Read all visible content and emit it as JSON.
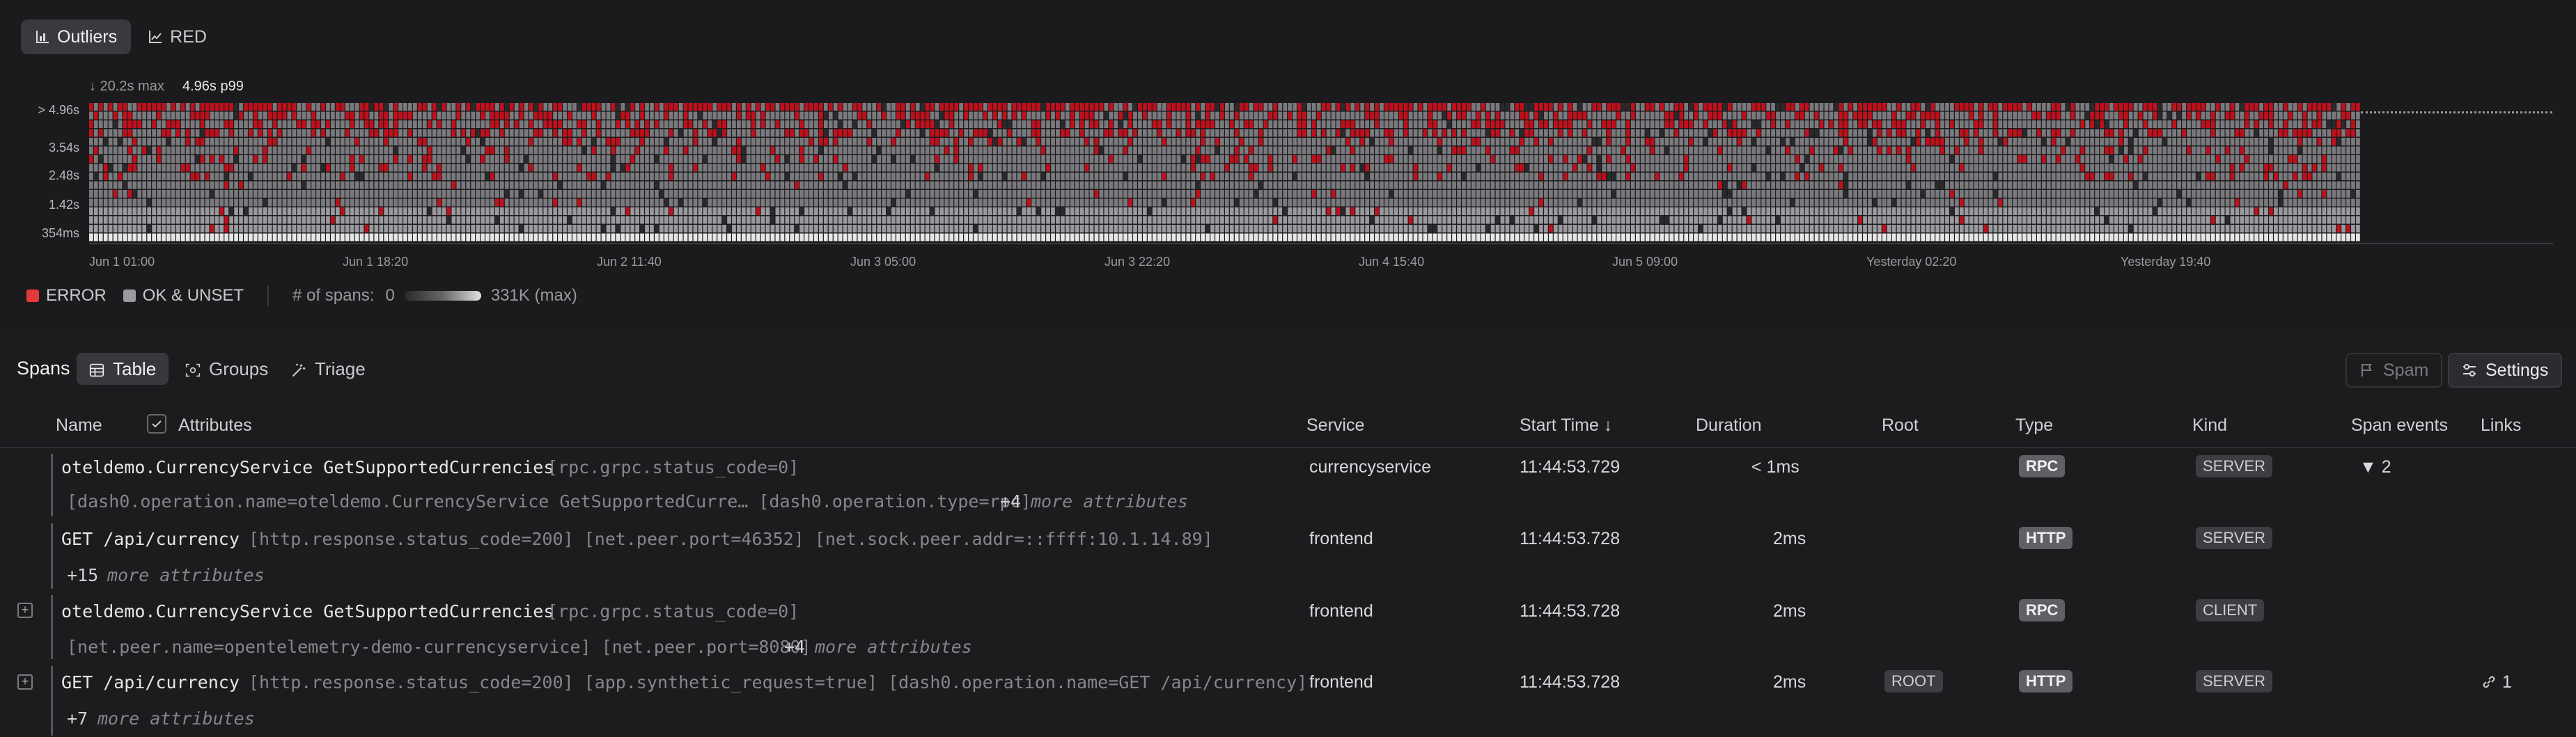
{
  "view_tabs": [
    {
      "label": "Outliers",
      "active": true
    },
    {
      "label": "RED",
      "active": false
    }
  ],
  "chart_header": {
    "max_label": "↓ 20.2s max",
    "p99_label": "4.96s p99"
  },
  "chart_data": {
    "type": "heatmap",
    "title": "",
    "y_ticks": [
      "> 4.96s",
      "3.54s",
      "2.48s",
      "1.42s",
      "354ms"
    ],
    "x_ticks": [
      "Jun 1 01:00",
      "Jun 1 18:20",
      "Jun 2 11:40",
      "Jun 3 05:00",
      "Jun 3 22:20",
      "Jun 4 15:40",
      "Jun 5 09:00",
      "Yesterday 02:20",
      "Yesterday 19:40"
    ],
    "legend": [
      {
        "name": "ERROR",
        "color": "#e5383b"
      },
      {
        "name": "OK & UNSET",
        "color": "#9a9a9e"
      }
    ],
    "count_scale": {
      "label": "# of spans:",
      "min": "0",
      "max": "331K (max)"
    },
    "colors": {
      "error": "#c0101c",
      "ok": "#7a7a7e",
      "bright": "#e6e6e6"
    }
  },
  "toolbar": {
    "title": "Spans",
    "tabs": [
      {
        "label": "Table",
        "active": true
      },
      {
        "label": "Groups",
        "active": false
      },
      {
        "label": "Triage",
        "active": false
      }
    ],
    "spam_label": "Spam",
    "settings_label": "Settings"
  },
  "columns": {
    "name": "Name",
    "attributes": "Attributes",
    "service": "Service",
    "start_time": "Start Time ↓",
    "duration": "Duration",
    "root": "Root",
    "type": "Type",
    "kind": "Kind",
    "span_events": "Span events",
    "links": "Links"
  },
  "rows": [
    {
      "name": "oteldemo.CurrencyService GetSupportedCurrencies",
      "attrs1": "[rpc.grpc.status_code=0]",
      "attrs2": "[dash0.operation.name=oteldemo.CurrencyService GetSupportedCurre…  [dash0.operation.type=rpc]",
      "more_count": "+4",
      "more_text": "more attributes",
      "service": "currencyservice",
      "start": "11:44:53.729",
      "duration": "< 1ms",
      "root": "",
      "type": "RPC",
      "kind": "SERVER",
      "events": "▼ 2",
      "links": ""
    },
    {
      "name": "GET /api/currency",
      "attrs1": "[http.response.status_code=200] [net.peer.port=46352] [net.sock.peer.addr=::ffff:10.1.14.89]",
      "attrs2": "",
      "more_count": "+15",
      "more_text": "more attributes",
      "service": "frontend",
      "start": "11:44:53.728",
      "duration": "2ms",
      "root": "",
      "type": "HTTP",
      "kind": "SERVER",
      "events": "",
      "links": ""
    },
    {
      "name": "oteldemo.CurrencyService GetSupportedCurrencies",
      "attrs1": "[rpc.grpc.status_code=0]",
      "attrs2": "[net.peer.name=opentelemetry-demo-currencyservice] [net.peer.port=8080]",
      "more_count": "+4",
      "more_text": "more attributes",
      "service": "frontend",
      "start": "11:44:53.728",
      "duration": "2ms",
      "root": "",
      "type": "RPC",
      "kind": "CLIENT",
      "events": "",
      "links": ""
    },
    {
      "name": "GET /api/currency",
      "attrs1": "[http.response.status_code=200] [app.synthetic_request=true] [dash0.operation.name=GET /api/currency]",
      "attrs2": "",
      "more_count": "+7",
      "more_text": "more attributes",
      "service": "frontend",
      "start": "11:44:53.728",
      "duration": "2ms",
      "root": "ROOT",
      "type": "HTTP",
      "kind": "SERVER",
      "events": "",
      "links": "1"
    }
  ]
}
